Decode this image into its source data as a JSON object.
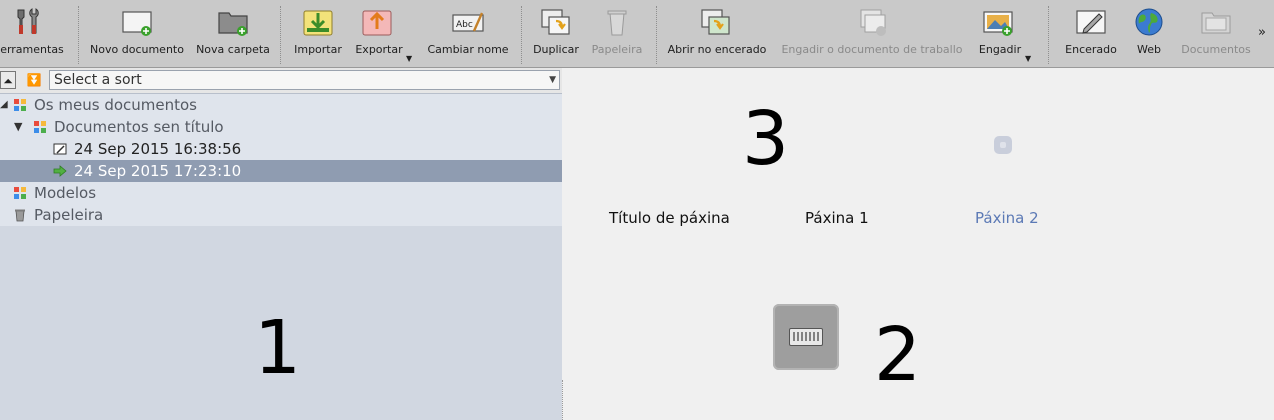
{
  "toolbar": {
    "items": [
      {
        "label": "erramentas",
        "icon": "tools-icon",
        "disabled": false
      },
      {
        "label": "Novo documento",
        "icon": "new-document-icon",
        "disabled": false
      },
      {
        "label": "Nova carpeta",
        "icon": "new-folder-icon",
        "disabled": false
      },
      {
        "label": "Importar",
        "icon": "import-icon",
        "disabled": false
      },
      {
        "label": "Exportar",
        "icon": "export-icon",
        "disabled": false,
        "has_dropdown": true
      },
      {
        "label": "Cambiar nome",
        "icon": "rename-icon",
        "disabled": false
      },
      {
        "label": "Duplicar",
        "icon": "duplicate-icon",
        "disabled": false
      },
      {
        "label": "Papeleira",
        "icon": "trash-icon",
        "disabled": true
      },
      {
        "label": "Abrir no encerado",
        "icon": "open-in-journal-icon",
        "disabled": false
      },
      {
        "label": "Engadir o documento de traballo",
        "icon": "add-working-document-icon",
        "disabled": true
      },
      {
        "label": "Engadir",
        "icon": "add-image-icon",
        "disabled": false,
        "has_dropdown": true
      },
      {
        "label": "Encerado",
        "icon": "whiteboard-icon",
        "disabled": false
      },
      {
        "label": "Web",
        "icon": "globe-icon",
        "disabled": false
      },
      {
        "label": "Documentos",
        "icon": "documents-folder-icon",
        "disabled": true
      }
    ],
    "overflow": "»"
  },
  "sort": {
    "placeholder": "Select a sort",
    "up_icon": "collapse-up-icon",
    "down_icon": "expand-down-icon"
  },
  "tree": [
    {
      "label": "Os meus documentos",
      "icon": "my-documents-icon",
      "expanded": true
    },
    {
      "label": "Documentos sen título",
      "icon": "folder-icon",
      "expanded": true
    },
    {
      "label": "24 Sep 2015 16:38:56",
      "icon": "edit-document-icon"
    },
    {
      "label": "24 Sep 2015 17:23:10",
      "icon": "current-document-arrow-icon",
      "selected": true
    },
    {
      "label": "Modelos",
      "icon": "models-icon"
    },
    {
      "label": "Papeleira",
      "icon": "trash-icon"
    }
  ],
  "annotations": {
    "left_number": "1",
    "keyboard_number": "2",
    "page_number": "3"
  },
  "pages": [
    {
      "label": "Título de páxina",
      "selected": false
    },
    {
      "label": "Páxina 1",
      "selected": false
    },
    {
      "label": "Páxina 2",
      "selected": true
    }
  ],
  "colors": {
    "toolbar_bg": "#c9c9c9",
    "tree_bg": "#d1d7e1",
    "selection": "#8f9cb1",
    "selected_page_text": "#5b79b5"
  }
}
